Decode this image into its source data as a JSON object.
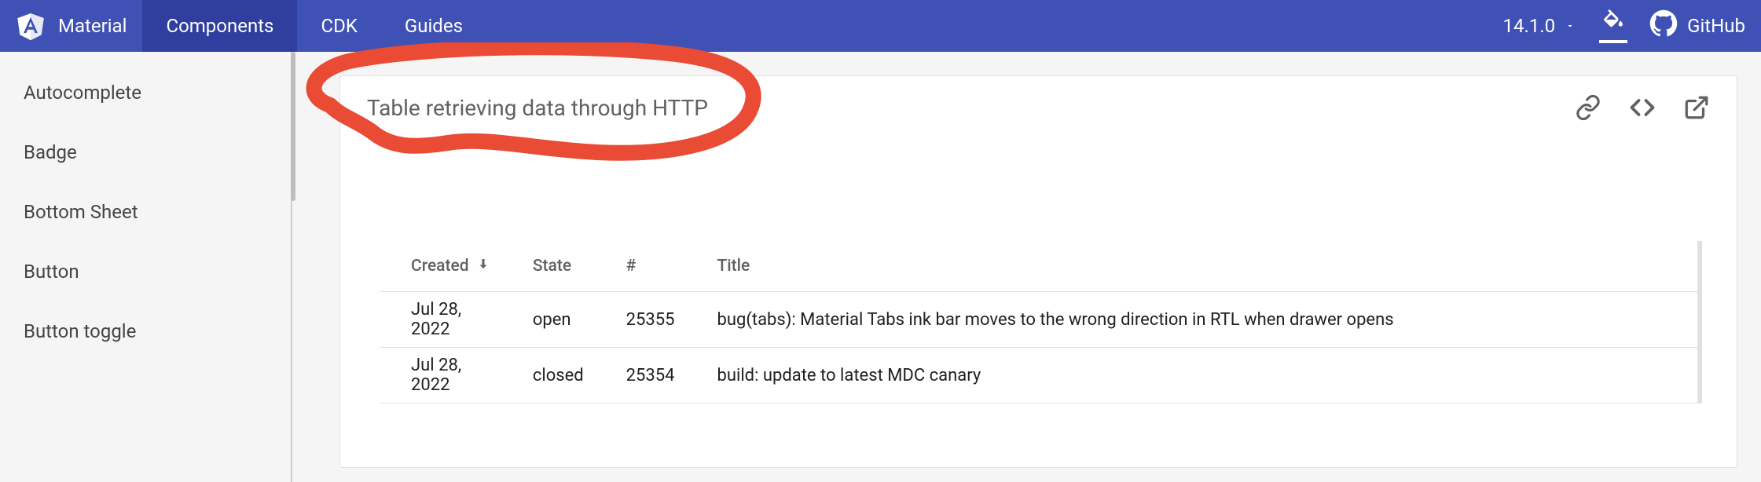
{
  "header": {
    "brand": "Material",
    "nav": [
      {
        "label": "Components",
        "active": true
      },
      {
        "label": "CDK",
        "active": false
      },
      {
        "label": "Guides",
        "active": false
      }
    ],
    "version": "14.1.0",
    "github_label": "GitHub"
  },
  "sidebar": {
    "items": [
      {
        "label": "Autocomplete"
      },
      {
        "label": "Badge"
      },
      {
        "label": "Bottom Sheet"
      },
      {
        "label": "Button"
      },
      {
        "label": "Button toggle"
      }
    ]
  },
  "example": {
    "title": "Table retrieving data through HTTP",
    "table": {
      "headers": {
        "created": "Created",
        "state": "State",
        "number": "#",
        "title": "Title"
      },
      "sort_column": "created",
      "sort_direction": "desc",
      "rows": [
        {
          "created": "Jul 28, 2022",
          "state": "open",
          "number": "25355",
          "title": "bug(tabs): Material Tabs ink bar moves to the wrong direction in RTL when drawer opens"
        },
        {
          "created": "Jul 28, 2022",
          "state": "closed",
          "number": "25354",
          "title": "build: update to latest MDC canary"
        }
      ]
    }
  },
  "annotation_color": "#e94b35"
}
